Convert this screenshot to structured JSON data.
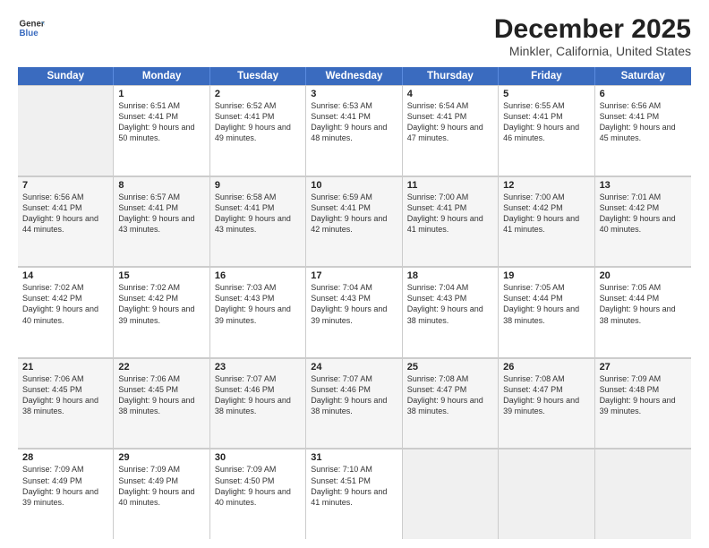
{
  "header": {
    "logo_line1": "General",
    "logo_line2": "Blue",
    "main_title": "December 2025",
    "subtitle": "Minkler, California, United States"
  },
  "calendar": {
    "headers": [
      "Sunday",
      "Monday",
      "Tuesday",
      "Wednesday",
      "Thursday",
      "Friday",
      "Saturday"
    ],
    "rows": [
      [
        {
          "day": "",
          "empty": true
        },
        {
          "day": "1",
          "sunrise": "6:51 AM",
          "sunset": "4:41 PM",
          "daylight": "9 hours and 50 minutes."
        },
        {
          "day": "2",
          "sunrise": "6:52 AM",
          "sunset": "4:41 PM",
          "daylight": "9 hours and 49 minutes."
        },
        {
          "day": "3",
          "sunrise": "6:53 AM",
          "sunset": "4:41 PM",
          "daylight": "9 hours and 48 minutes."
        },
        {
          "day": "4",
          "sunrise": "6:54 AM",
          "sunset": "4:41 PM",
          "daylight": "9 hours and 47 minutes."
        },
        {
          "day": "5",
          "sunrise": "6:55 AM",
          "sunset": "4:41 PM",
          "daylight": "9 hours and 46 minutes."
        },
        {
          "day": "6",
          "sunrise": "6:56 AM",
          "sunset": "4:41 PM",
          "daylight": "9 hours and 45 minutes."
        }
      ],
      [
        {
          "day": "7",
          "sunrise": "6:56 AM",
          "sunset": "4:41 PM",
          "daylight": "9 hours and 44 minutes."
        },
        {
          "day": "8",
          "sunrise": "6:57 AM",
          "sunset": "4:41 PM",
          "daylight": "9 hours and 43 minutes."
        },
        {
          "day": "9",
          "sunrise": "6:58 AM",
          "sunset": "4:41 PM",
          "daylight": "9 hours and 43 minutes."
        },
        {
          "day": "10",
          "sunrise": "6:59 AM",
          "sunset": "4:41 PM",
          "daylight": "9 hours and 42 minutes."
        },
        {
          "day": "11",
          "sunrise": "7:00 AM",
          "sunset": "4:41 PM",
          "daylight": "9 hours and 41 minutes."
        },
        {
          "day": "12",
          "sunrise": "7:00 AM",
          "sunset": "4:42 PM",
          "daylight": "9 hours and 41 minutes."
        },
        {
          "day": "13",
          "sunrise": "7:01 AM",
          "sunset": "4:42 PM",
          "daylight": "9 hours and 40 minutes."
        }
      ],
      [
        {
          "day": "14",
          "sunrise": "7:02 AM",
          "sunset": "4:42 PM",
          "daylight": "9 hours and 40 minutes."
        },
        {
          "day": "15",
          "sunrise": "7:02 AM",
          "sunset": "4:42 PM",
          "daylight": "9 hours and 39 minutes."
        },
        {
          "day": "16",
          "sunrise": "7:03 AM",
          "sunset": "4:43 PM",
          "daylight": "9 hours and 39 minutes."
        },
        {
          "day": "17",
          "sunrise": "7:04 AM",
          "sunset": "4:43 PM",
          "daylight": "9 hours and 39 minutes."
        },
        {
          "day": "18",
          "sunrise": "7:04 AM",
          "sunset": "4:43 PM",
          "daylight": "9 hours and 38 minutes."
        },
        {
          "day": "19",
          "sunrise": "7:05 AM",
          "sunset": "4:44 PM",
          "daylight": "9 hours and 38 minutes."
        },
        {
          "day": "20",
          "sunrise": "7:05 AM",
          "sunset": "4:44 PM",
          "daylight": "9 hours and 38 minutes."
        }
      ],
      [
        {
          "day": "21",
          "sunrise": "7:06 AM",
          "sunset": "4:45 PM",
          "daylight": "9 hours and 38 minutes."
        },
        {
          "day": "22",
          "sunrise": "7:06 AM",
          "sunset": "4:45 PM",
          "daylight": "9 hours and 38 minutes."
        },
        {
          "day": "23",
          "sunrise": "7:07 AM",
          "sunset": "4:46 PM",
          "daylight": "9 hours and 38 minutes."
        },
        {
          "day": "24",
          "sunrise": "7:07 AM",
          "sunset": "4:46 PM",
          "daylight": "9 hours and 38 minutes."
        },
        {
          "day": "25",
          "sunrise": "7:08 AM",
          "sunset": "4:47 PM",
          "daylight": "9 hours and 38 minutes."
        },
        {
          "day": "26",
          "sunrise": "7:08 AM",
          "sunset": "4:47 PM",
          "daylight": "9 hours and 39 minutes."
        },
        {
          "day": "27",
          "sunrise": "7:09 AM",
          "sunset": "4:48 PM",
          "daylight": "9 hours and 39 minutes."
        }
      ],
      [
        {
          "day": "28",
          "sunrise": "7:09 AM",
          "sunset": "4:49 PM",
          "daylight": "9 hours and 39 minutes."
        },
        {
          "day": "29",
          "sunrise": "7:09 AM",
          "sunset": "4:49 PM",
          "daylight": "9 hours and 40 minutes."
        },
        {
          "day": "30",
          "sunrise": "7:09 AM",
          "sunset": "4:50 PM",
          "daylight": "9 hours and 40 minutes."
        },
        {
          "day": "31",
          "sunrise": "7:10 AM",
          "sunset": "4:51 PM",
          "daylight": "9 hours and 41 minutes."
        },
        {
          "day": "",
          "empty": true
        },
        {
          "day": "",
          "empty": true
        },
        {
          "day": "",
          "empty": true
        }
      ]
    ]
  }
}
